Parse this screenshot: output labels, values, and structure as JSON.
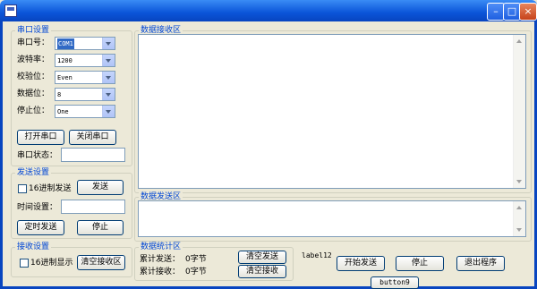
{
  "window": {
    "title": "",
    "controls": {
      "minimize": "–",
      "maximize": "□",
      "close": "×"
    }
  },
  "serial_settings": {
    "title": "串口设置",
    "fields": [
      {
        "label": "串口号：",
        "value": "COM1",
        "selected": true
      },
      {
        "label": "波特率：",
        "value": "1200"
      },
      {
        "label": "校验位：",
        "value": "Even"
      },
      {
        "label": "数据位：",
        "value": "8"
      },
      {
        "label": "停止位：",
        "value": "One"
      }
    ],
    "open_button": "打开串口",
    "close_button": "关闭串口",
    "status_label": "串口状态：",
    "status_value": ""
  },
  "send_settings": {
    "title": "发送设置",
    "hex_send_label": "16进制发送",
    "send_button": "发送",
    "time_label": "时间设置：",
    "time_value": "",
    "timed_send_button": "定时发送",
    "stop_button": "停止"
  },
  "recv_settings": {
    "title": "接收设置",
    "hex_display_label": "16进制显示",
    "clear_recv_button": "清空接收区"
  },
  "recv_area": {
    "title": "数据接收区",
    "content": ""
  },
  "send_area": {
    "title": "数据发送区",
    "content": ""
  },
  "stats": {
    "title": "数据统计区",
    "sent_label": "累计发送：",
    "sent_value": "0字节",
    "recv_label": "累计接收：",
    "recv_value": "0字节",
    "clear_sent_button": "清空发送",
    "clear_recv_button": "清空接收"
  },
  "misc": {
    "label12": "label12",
    "start_send_button": "开始发送",
    "stop_button": "停止",
    "exit_button": "退出程序",
    "button9": "button9"
  },
  "colors": {
    "title_bar": "#0a54d8",
    "group_title": "#0046d5",
    "background": "#ece9d8"
  }
}
